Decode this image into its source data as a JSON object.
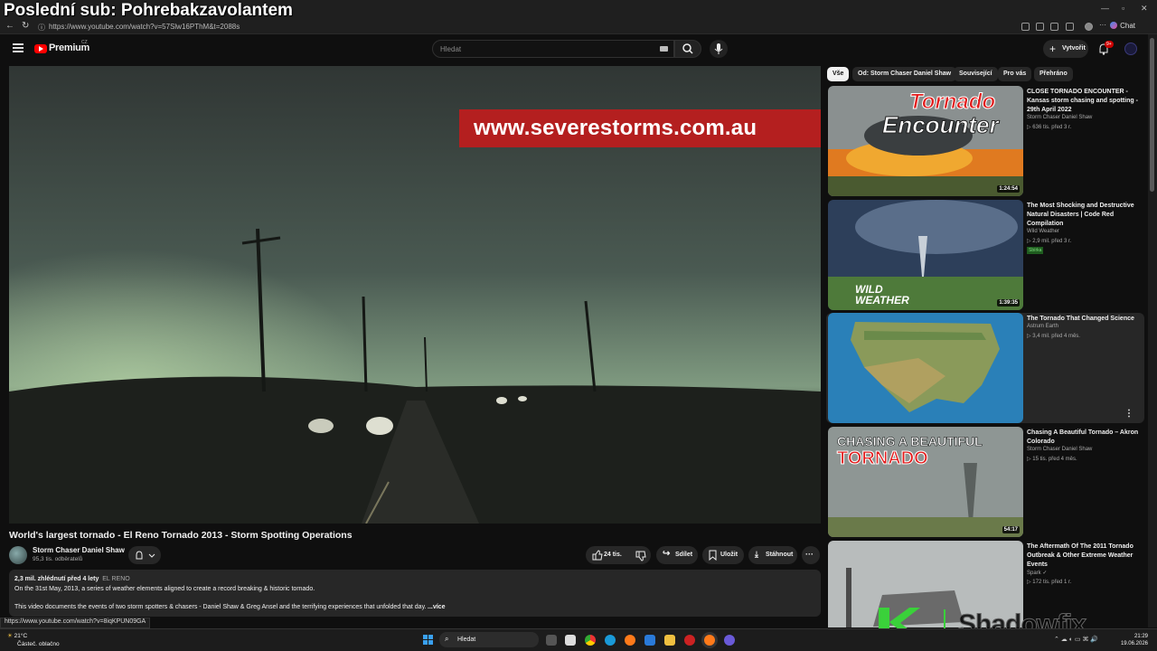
{
  "overlay_title": "Poslední sub: Pohrebakzavolantem",
  "browser": {
    "url": "https://www.youtube.com/watch?v=57Slw16PThM&t=2088s",
    "chat_label": "Chat"
  },
  "header": {
    "brand": "Premium",
    "brand_country": "CZ",
    "search_placeholder": "Hledat",
    "create_label": "Vytvořit",
    "notif_count": "9+"
  },
  "player": {
    "overlay_banner": "www.severestorms.com.au"
  },
  "video": {
    "title": "World's largest tornado - El Reno Tornado 2013 - Storm Spotting Operations",
    "channel": "Storm Chaser Daniel Shaw",
    "subscribers": "95,3 tis. odběratelů",
    "likes": "24 tis.",
    "share_label": "Sdílet",
    "save_label": "Uložit",
    "download_label": "Stáhnout",
    "views_date": "2,3 mil. zhlédnutí  před 4 lety",
    "location_tag": "EL RENO",
    "desc_line1": "On the 31st May, 2013, a series of weather elements aligned to create a record breaking & historic tornado.",
    "desc_line2": "This video documents the events of two storm spotters & chasers - Daniel Shaw & Greg Ansel and the terrifying experiences that unfolded that day.",
    "more_label": "...více"
  },
  "status_bar_url": "https://www.youtube.com/watch?v=8iqKPUN09GA",
  "chips": [
    "Vše",
    "Od: Storm Chaser Daniel Shaw",
    "Související",
    "Pro vás",
    "Přehráno"
  ],
  "recommendations": [
    {
      "title": "CLOSE TORNADO ENCOUNTER - Kansas storm chasing and spotting - 29th April 2022",
      "channel": "Storm Chaser Daniel Shaw",
      "meta": "636 tis.  před 3 r.",
      "duration": "1:24:54",
      "thumb_text1": "Tornado",
      "thumb_text2": "Encounter"
    },
    {
      "title": "The Most Shocking and Destructive Natural Disasters | Code Red Compilation",
      "channel": "Wild Weather",
      "meta": "2,9 mil.  před 3 r.",
      "badge": "Sbírka",
      "duration": "1:39:35",
      "thumb_text1": "WILD",
      "thumb_text2": "WEATHER"
    },
    {
      "title": "The Tornado That Changed Science",
      "channel": "Astrum Earth",
      "meta": "3,4 mil.  před 4 měs."
    },
    {
      "title": "Chasing A Beautiful Tornado – Akron Colorado",
      "channel": "Storm Chaser Daniel Shaw",
      "meta": "15 tis.  před 4 měs.",
      "duration": "54:17",
      "thumb_text1": "CHASING A BEAUTIFUL",
      "thumb_text2": "TORNADO"
    },
    {
      "title": "The Aftermath Of The 2011 Tornado Outbreak & Other Extreme Weather Events",
      "channel": "Spark",
      "meta": "172 tis.  před 1 r."
    }
  ],
  "taskbar": {
    "temp": "21°C",
    "weather_desc": "Částeč. oblačno",
    "search_label": "Hledat",
    "time": "21:29",
    "date": "19.06.2026"
  },
  "watermark": "Shadowfix",
  "colors": {
    "yt_red": "#ff0000",
    "banner_red": "#b41f1f",
    "bg": "#0f0f0f"
  }
}
